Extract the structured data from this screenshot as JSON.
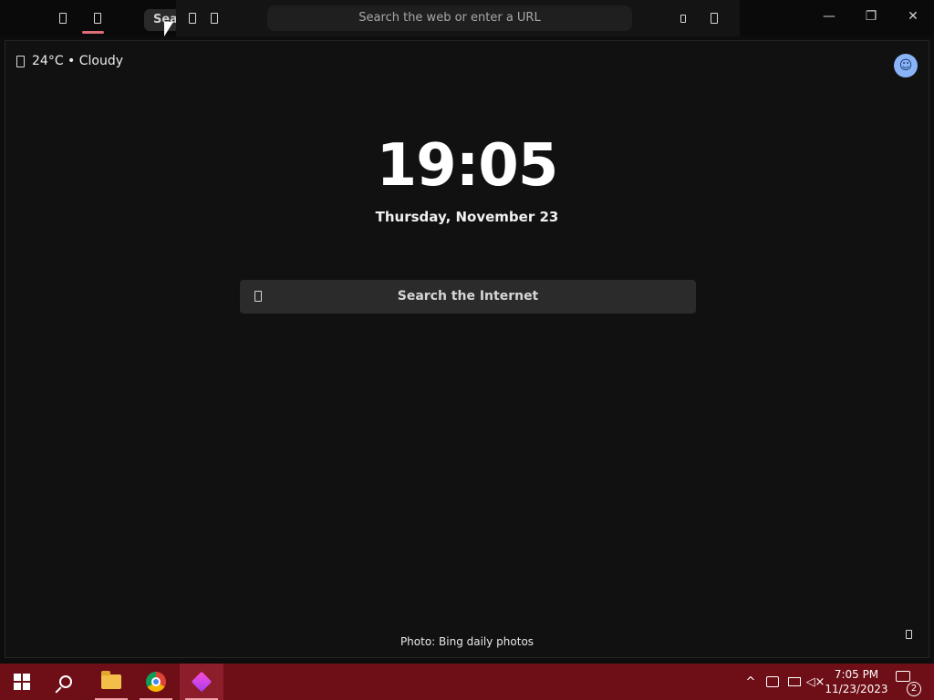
{
  "browser": {
    "tab_chip_label": "Sear",
    "address_placeholder": "Search the web or enter a URL",
    "window_controls": {
      "minimize": "—",
      "restore": "❐",
      "close": "✕"
    }
  },
  "newtab": {
    "weather": "24°C • Cloudy",
    "time": "19:05",
    "date": "Thursday, November 23",
    "search_label": "Search the Internet",
    "photo_credit": "Photo: Bing daily photos",
    "avatar_icon": "face-icon"
  },
  "taskbar": {
    "apps": [
      {
        "name": "start",
        "icon": "windows-logo-icon"
      },
      {
        "name": "search",
        "icon": "search-icon"
      },
      {
        "name": "file-explorer",
        "icon": "folder-icon"
      },
      {
        "name": "chrome",
        "icon": "chrome-icon"
      },
      {
        "name": "browser-app",
        "icon": "app-diamond-icon",
        "active": true
      }
    ],
    "clock_time": "7:05 PM",
    "clock_date": "11/23/2023",
    "notification_count": "2"
  },
  "colors": {
    "taskbar": "#6e0e16",
    "tab_indicator": "#e06c75",
    "page_bg": "#111111",
    "search_bg": "#2b2b2b"
  }
}
